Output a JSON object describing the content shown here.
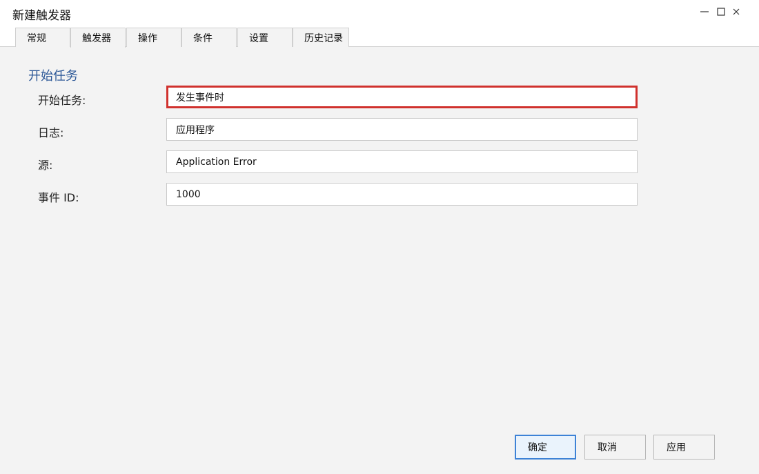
{
  "window": {
    "title": "新建触发器"
  },
  "tabs": [
    {
      "label": "常规"
    },
    {
      "label": "触发器"
    },
    {
      "label": "操作"
    },
    {
      "label": "条件"
    },
    {
      "label": "设置"
    },
    {
      "label": "历史记录"
    }
  ],
  "section": {
    "title": "开始任务"
  },
  "form": {
    "begin_task": {
      "label": "开始任务:",
      "value": "发生事件时"
    },
    "log": {
      "label": "日志:",
      "value": "应用程序"
    },
    "source": {
      "label": "源:",
      "value": "Application Error"
    },
    "event_id": {
      "label": "事件 ID:",
      "value": "1000"
    }
  },
  "buttons": {
    "ok": "确定",
    "cancel": "取消",
    "apply": "应用"
  },
  "colors": {
    "section_title": "#2b5797",
    "highlight_border": "#d0312d",
    "primary_border": "#3d82d6"
  }
}
